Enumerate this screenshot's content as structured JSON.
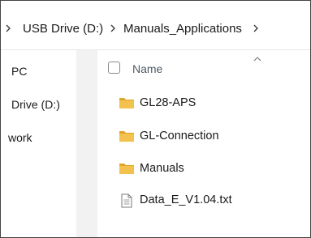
{
  "breadcrumb": {
    "items": [
      "USB Drive (D:)",
      "Manuals_Applications"
    ]
  },
  "sidebar": {
    "items": [
      "PC",
      "Drive (D:)",
      "work"
    ]
  },
  "columns": {
    "name_header": "Name"
  },
  "files": [
    {
      "name": "GL28-APS",
      "type": "folder"
    },
    {
      "name": "GL-Connection",
      "type": "folder"
    },
    {
      "name": "Manuals",
      "type": "folder"
    },
    {
      "name": "Data_E_V1.04.txt",
      "type": "text-file"
    }
  ],
  "colors": {
    "folder": "#f2c14e",
    "folder_dark": "#e0a528",
    "header_text": "#4d5a66",
    "sidebar_strip": "#f2f2f2"
  }
}
